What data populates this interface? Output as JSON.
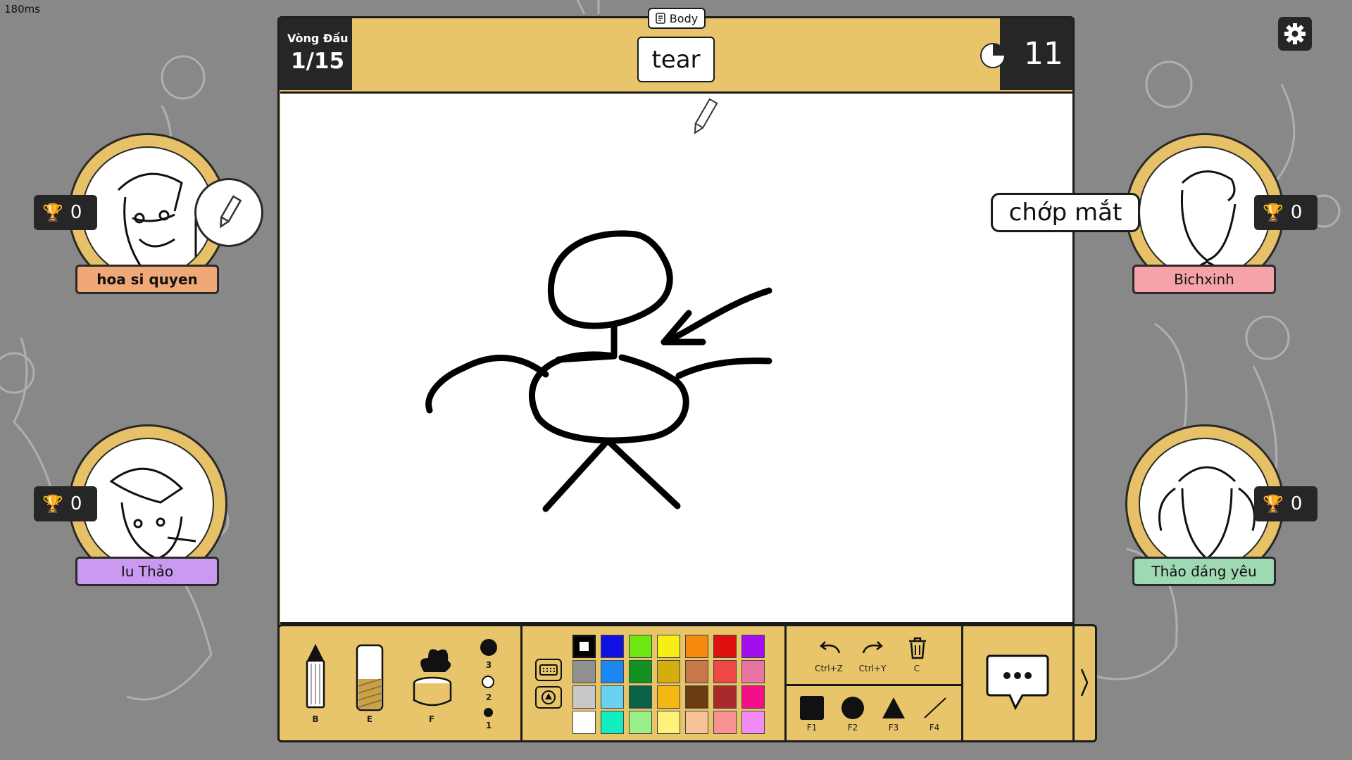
{
  "ping": "180ms",
  "round": {
    "label": "Vòng Đấu",
    "value": "1/15"
  },
  "timer": {
    "value": "11"
  },
  "category": {
    "label": "Body"
  },
  "word": {
    "text": "tear"
  },
  "players": [
    {
      "name": "hoa si quyen",
      "score": "0",
      "plate_color": "#f1a878",
      "role": "drawing"
    },
    {
      "name": "Iu Thảo",
      "score": "0",
      "plate_color": "#c99af0"
    },
    {
      "name": "Bichxinh",
      "score": "0",
      "plate_color": "#f5a3a8"
    },
    {
      "name": "Thảo đáng yêu",
      "score": "0",
      "plate_color": "#9fd9b3"
    }
  ],
  "chat_bubble": {
    "text": "chớp mắt"
  },
  "tools": [
    {
      "name": "pencil",
      "key": "B"
    },
    {
      "name": "eraser",
      "key": "E"
    },
    {
      "name": "fill-bucket",
      "key": "F"
    }
  ],
  "brush_sizes": [
    "3",
    "2",
    "1"
  ],
  "palette": [
    [
      "#000000",
      "#1010e0",
      "#6ee612",
      "#f7ee15",
      "#f58a0e",
      "#e01010",
      "#a20ef0"
    ],
    [
      "#909090",
      "#1b88f2",
      "#119222",
      "#d4ae10",
      "#c7774a",
      "#ee4848",
      "#e874a4"
    ],
    [
      "#c8c8c8",
      "#6bd1f2",
      "#0b6146",
      "#f4b814",
      "#6a3c10",
      "#a82a2a",
      "#f2108a"
    ],
    [
      "#ffffff",
      "#12eec2",
      "#98f08a",
      "#fdf27a",
      "#f6c296",
      "#f89292",
      "#f48af4"
    ]
  ],
  "actions": [
    {
      "name": "undo",
      "key": "Ctrl+Z"
    },
    {
      "name": "redo",
      "key": "Ctrl+Y"
    },
    {
      "name": "clear",
      "key": "C"
    }
  ],
  "shapes": [
    {
      "name": "rectangle",
      "key": "F1"
    },
    {
      "name": "circle",
      "key": "F2"
    },
    {
      "name": "triangle",
      "key": "F3"
    },
    {
      "name": "line",
      "key": "F4"
    }
  ],
  "colors": {
    "frame": "#e8c46a",
    "dark": "#262626",
    "background": "#888888"
  }
}
